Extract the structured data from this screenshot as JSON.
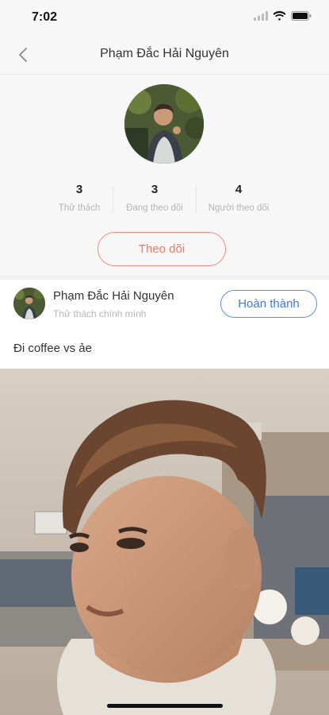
{
  "status_bar": {
    "time": "7:02",
    "icons": [
      "signal-icon",
      "wifi-icon",
      "battery-icon"
    ]
  },
  "nav": {
    "back_icon": "chevron-left-icon",
    "title": "Phạm Đắc Hải Nguyên"
  },
  "profile": {
    "avatar": "profile-avatar-photo",
    "stats": [
      {
        "value": "3",
        "label": "Thử thách"
      },
      {
        "value": "3",
        "label": "Đang theo dõi"
      },
      {
        "value": "4",
        "label": "Người theo dõi"
      }
    ],
    "follow_label": "Theo dõi"
  },
  "post": {
    "author": "Phạm Đắc Hải Nguyên",
    "subtitle": "Thử thách chính mình",
    "complete_label": "Hoàn thành",
    "caption": "Đi coffee vs ảe",
    "photo": "post-photo"
  },
  "colors": {
    "follow_accent": "#f0776b",
    "complete_accent": "#3f78e0",
    "header_bg": "#f7f7f7"
  }
}
